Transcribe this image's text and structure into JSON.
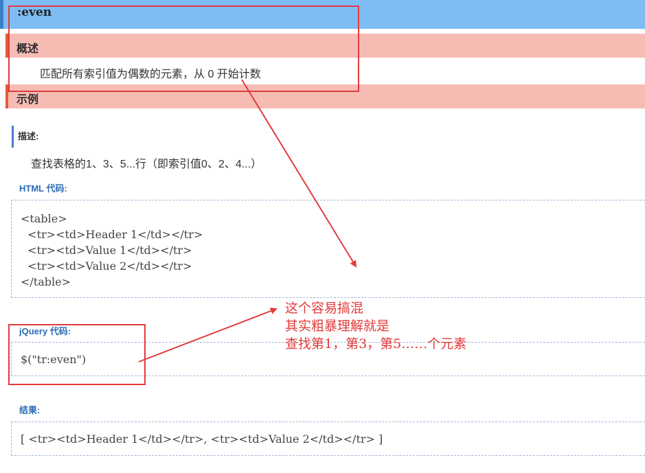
{
  "header": {
    "title": ":even"
  },
  "overview": {
    "heading": "概述",
    "text": "匹配所有索引值为偶数的元素，从 0 开始计数"
  },
  "example": {
    "heading": "示例"
  },
  "description": {
    "label": "描述:",
    "text": "查找表格的1、3、5...行（即索引值0、2、4...）"
  },
  "html_code": {
    "label": "HTML 代码:",
    "lines": [
      "<table>",
      "  <tr><td>Header 1</td></tr>",
      "  <tr><td>Value 1</td></tr>",
      "  <tr><td>Value 2</td></tr>",
      "</table>"
    ]
  },
  "jquery_code": {
    "label": "jQuery 代码:",
    "code": "$(\"tr:even\")"
  },
  "result": {
    "label": "结果:",
    "code": "[ <tr><td>Header 1</td></tr>, <tr><td>Value 2</td></tr> ]"
  },
  "annotation": {
    "lines": [
      "这个容易搞混",
      "其实粗暴理解就是",
      "查找第1，第3，第5……个元素"
    ],
    "color": "#e23b3b"
  },
  "colors": {
    "title_bar": "#7dbdf4",
    "section_bar": "#f6bcb4",
    "label_blue": "#2a6bb7"
  }
}
